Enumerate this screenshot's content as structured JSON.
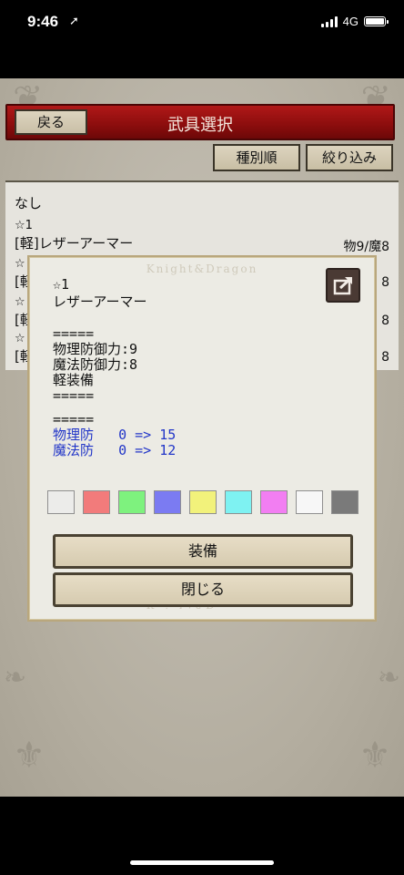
{
  "status": {
    "time": "9:46",
    "network": "4G",
    "location_icon": "location-arrow-icon"
  },
  "header": {
    "title": "武具選択",
    "back_label": "戻る"
  },
  "toolbar": {
    "sort_label": "種別順",
    "filter_label": "絞り込み"
  },
  "list": {
    "none_label": "なし",
    "items": [
      {
        "rank": "☆1",
        "name": "[軽]レザーアーマー",
        "stats": "物9/魔8"
      },
      {
        "rank": "☆",
        "name": "[軽",
        "stats": "8"
      },
      {
        "rank": "☆",
        "name": "[軽",
        "stats": "8"
      },
      {
        "rank": "☆",
        "name": "[軽",
        "stats": "8"
      }
    ]
  },
  "dialog": {
    "watermark": "Knight&Dragon",
    "rank": "☆1",
    "name": "レザーアーマー",
    "sep1": "=====",
    "phys_def": "物理防御力:9",
    "mag_def": "魔法防御力:8",
    "equip_type": "軽装備",
    "sep2": "=====",
    "sep3": "=====",
    "phys_change": "物理防   0 => 15",
    "mag_change": "魔法防   0 => 12",
    "swatch_colors": [
      "#ececea",
      "#f27b7b",
      "#7ef27e",
      "#7b7bf2",
      "#f2f27b",
      "#7ef2f2",
      "#f27ef2",
      "#f7f7f7",
      "#7a7a7a"
    ],
    "equip_label": "装備",
    "close_label": "閉じる",
    "share_icon": "share-icon"
  }
}
